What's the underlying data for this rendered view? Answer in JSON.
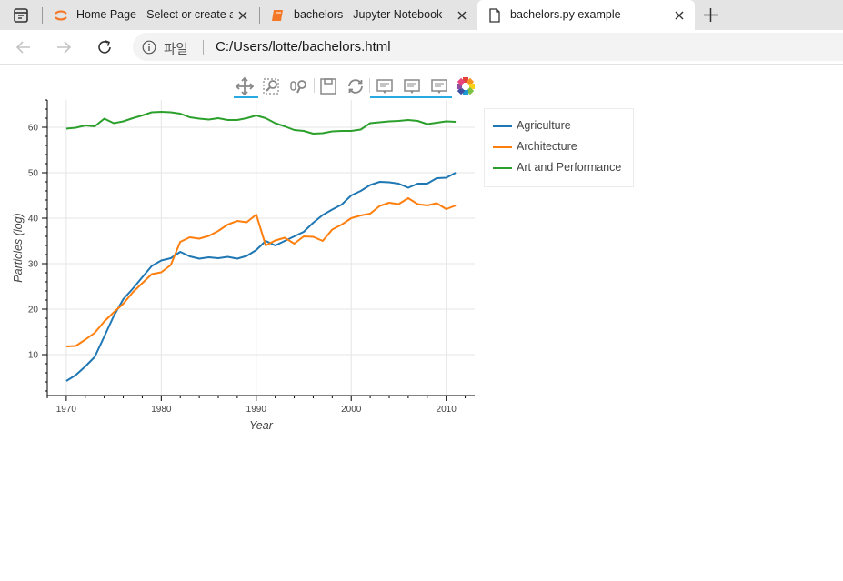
{
  "browser": {
    "tabs": [
      {
        "title": "Home Page - Select or create a n",
        "active": false
      },
      {
        "title": "bachelors - Jupyter Notebook",
        "active": false
      },
      {
        "title": "bachelors.py example",
        "active": true
      }
    ],
    "address": {
      "info_label": "파일",
      "url": "C:/Users/lotte/bachelors.html"
    }
  },
  "toolbar": {
    "tools": [
      "pan-tool",
      "box-zoom-tool",
      "wheel-zoom-tool",
      "save-tool",
      "reset-tool",
      "hover-tool-1",
      "hover-tool-2",
      "hover-tool-3",
      "bokeh-logo"
    ]
  },
  "colors": {
    "agriculture": "#1f77b4",
    "architecture": "#ff7f0e",
    "art_and_performance": "#2ca02c"
  },
  "chart_data": {
    "type": "line",
    "title": "",
    "xlabel": "Year",
    "ylabel": "Particles (log)",
    "xlim": [
      1968,
      2013
    ],
    "ylim": [
      1,
      66
    ],
    "x_ticks": [
      1970,
      1980,
      1990,
      2000,
      2010
    ],
    "y_ticks": [
      10,
      20,
      30,
      40,
      50,
      60
    ],
    "grid": true,
    "legend_position": "right",
    "x": [
      1970,
      1971,
      1972,
      1973,
      1974,
      1975,
      1976,
      1977,
      1978,
      1979,
      1980,
      1981,
      1982,
      1983,
      1984,
      1985,
      1986,
      1987,
      1988,
      1989,
      1990,
      1991,
      1992,
      1993,
      1994,
      1995,
      1996,
      1997,
      1998,
      1999,
      2000,
      2001,
      2002,
      2003,
      2004,
      2005,
      2006,
      2007,
      2008,
      2009,
      2010,
      2011
    ],
    "series": [
      {
        "name": "Agriculture",
        "color": "#1f77b4",
        "values": [
          4.2,
          5.5,
          7.4,
          9.5,
          14.0,
          18.5,
          22.2,
          24.5,
          27.0,
          29.5,
          30.7,
          31.2,
          32.6,
          31.6,
          31.1,
          31.4,
          31.2,
          31.5,
          31.1,
          31.7,
          33.0,
          35.0,
          34.0,
          35.0,
          36.0,
          37.0,
          39.0,
          40.7,
          41.9,
          43.0,
          45.0,
          46.0,
          47.3,
          48.0,
          47.9,
          47.6,
          46.7,
          47.6,
          47.6,
          48.8,
          48.9,
          50.0
        ]
      },
      {
        "name": "Architecture",
        "color": "#ff7f0e",
        "values": [
          11.8,
          11.9,
          13.3,
          14.8,
          17.3,
          19.3,
          21.2,
          23.7,
          25.7,
          27.7,
          28.1,
          29.7,
          34.8,
          35.8,
          35.5,
          36.1,
          37.2,
          38.6,
          39.4,
          39.1,
          40.8,
          34.0,
          35.1,
          35.7,
          34.4,
          36.0,
          35.9,
          35.0,
          37.5,
          38.6,
          40.0,
          40.6,
          41.0,
          42.7,
          43.4,
          43.1,
          44.4,
          43.1,
          42.8,
          43.3,
          42.0,
          42.8
        ]
      },
      {
        "name": "Art and Performance",
        "color": "#2ca02c",
        "values": [
          59.7,
          59.9,
          60.4,
          60.2,
          61.9,
          60.9,
          61.3,
          62.0,
          62.6,
          63.3,
          63.4,
          63.3,
          63.0,
          62.2,
          61.9,
          61.7,
          62.0,
          61.6,
          61.6,
          62.0,
          62.6,
          62.0,
          60.9,
          60.2,
          59.4,
          59.2,
          58.6,
          58.7,
          59.1,
          59.2,
          59.2,
          59.5,
          60.9,
          61.1,
          61.3,
          61.4,
          61.6,
          61.4,
          60.7,
          61.0,
          61.3,
          61.2
        ]
      }
    ]
  }
}
